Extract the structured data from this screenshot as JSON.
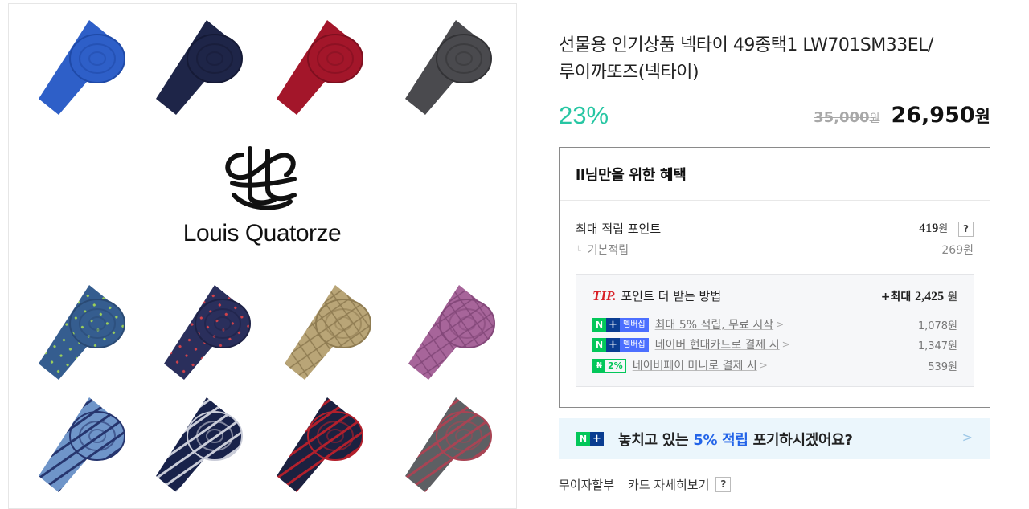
{
  "brand": {
    "name": "Louis Quatorze",
    "monogram": "LQ monogram logo"
  },
  "product": {
    "title_line1": "선물용 인기상품 넥타이 49종택1 LW701SM33EL/",
    "title_line2": "루이까또즈(넥타이)",
    "discount": "23%",
    "original_price": "35,000",
    "original_unit": "원",
    "sale_price": "26,950",
    "sale_unit": "원"
  },
  "benefits": {
    "title": "ll님만을 위한 혜택",
    "max_points_label": "최대 적립 포인트",
    "max_points_value": "419",
    "max_points_unit": "원",
    "help_label": "?",
    "basic_label": "기본적립",
    "basic_value": "269원",
    "tip": {
      "tip_word": "TIP.",
      "text": "포인트 더 받는 방법",
      "max_prefix": "+최대",
      "max_value": "2,425",
      "max_unit": "원",
      "items": [
        {
          "badge": "membership",
          "badge_text": "멤버십",
          "label": "최대 5% 적립, 무료 시작",
          "value": "1,078원"
        },
        {
          "badge": "membership",
          "badge_text": "멤버십",
          "label": "네이버 현대카드로 결제 시",
          "value": "1,347원"
        },
        {
          "badge": "pay",
          "badge_text": "2%",
          "label": "네이버페이 머니로 결제 시",
          "value": "539원"
        }
      ]
    }
  },
  "banner": {
    "text_before": "놓치고 있는",
    "highlight": "5% 적립",
    "text_after": "포기하시겠어요?"
  },
  "footer": {
    "installment": "무이자할부",
    "card_details": "카드 자세히보기",
    "help": "?"
  },
  "colors": {
    "discount": "#27c6a3",
    "naver_green": "#03c75a",
    "tip_red": "#d81f26",
    "highlight_blue": "#2364e8"
  },
  "ties": [
    {
      "name": "blue tie",
      "color": "#2e5fc8",
      "accent": "#1f4aa8",
      "pattern": "plain"
    },
    {
      "name": "navy tie",
      "color": "#1e2548",
      "accent": "#151a36",
      "pattern": "plain"
    },
    {
      "name": "red tie",
      "color": "#a3162a",
      "accent": "#7e0f1f",
      "pattern": "plain"
    },
    {
      "name": "gray tie",
      "color": "#4a4a4e",
      "accent": "#333336",
      "pattern": "plain"
    },
    {
      "name": "blue dot tie",
      "color": "#355d8f",
      "accent": "#2a4a74",
      "pattern": "dots"
    },
    {
      "name": "navy dot tie",
      "color": "#2a2f5c",
      "accent": "#1e2246",
      "pattern": "dots-red"
    },
    {
      "name": "beige pattern tie",
      "color": "#b9a577",
      "accent": "#8f7c52",
      "pattern": "grid"
    },
    {
      "name": "pink pattern tie",
      "color": "#a7659a",
      "accent": "#84487a",
      "pattern": "grid"
    },
    {
      "name": "light blue stripe tie",
      "color": "#6f95c9",
      "accent": "#26356e",
      "pattern": "stripes"
    },
    {
      "name": "navy stripe tie",
      "color": "#18224a",
      "accent": "#c9ccd8",
      "pattern": "stripes"
    },
    {
      "name": "navy red stripe tie",
      "color": "#1c2140",
      "accent": "#b3202c",
      "pattern": "stripes"
    },
    {
      "name": "gray red stripe tie",
      "color": "#5d5f63",
      "accent": "#a84454",
      "pattern": "stripes"
    }
  ]
}
